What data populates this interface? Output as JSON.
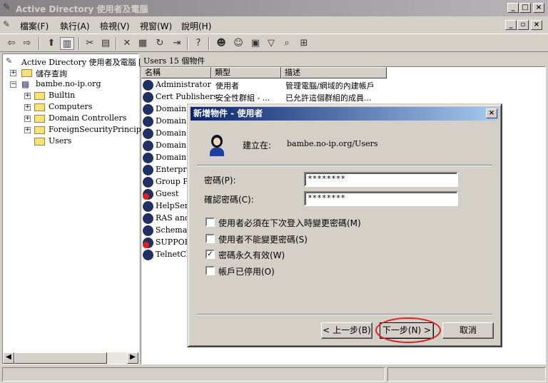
{
  "window": {
    "title": "Active Directory 使用者及電腦",
    "min": "_",
    "max": "□",
    "close": "×"
  },
  "menu": {
    "items": [
      "檔案(F)",
      "執行(A)",
      "檢視(V)",
      "視窗(W)",
      "說明(H)"
    ],
    "child_min": "_",
    "child_restore": "▫",
    "child_close": "×"
  },
  "tree": {
    "root": "Active Directory 使用者及電腦 [l",
    "saved_queries": "儲存查詢",
    "domain": "bambe.no-ip.org",
    "children": [
      "Builtin",
      "Computers",
      "Domain Controllers",
      "ForeignSecurityPrincipals",
      "Users"
    ]
  },
  "list": {
    "header": "Users   15 個物件",
    "columns": [
      "名稱",
      "類型",
      "描述"
    ],
    "rows": [
      {
        "name": "Administrator",
        "type": "使用者",
        "desc": "管理電腦/網域的內建帳戶",
        "error": false
      },
      {
        "name": "Cert Publishers",
        "type": "安全性群組 - ...",
        "desc": "已允許這個群組的成員...",
        "error": false
      },
      {
        "name": "Domain A",
        "type": "",
        "desc": "",
        "error": false
      },
      {
        "name": "Domain C",
        "type": "",
        "desc": "",
        "error": false
      },
      {
        "name": "Domain C",
        "type": "",
        "desc": "",
        "error": false
      },
      {
        "name": "Domain G",
        "type": "",
        "desc": "",
        "error": false
      },
      {
        "name": "Domain U",
        "type": "",
        "desc": "",
        "error": false
      },
      {
        "name": "Enterpris",
        "type": "",
        "desc": "",
        "error": false
      },
      {
        "name": "Group Po",
        "type": "",
        "desc": "",
        "error": false
      },
      {
        "name": "Guest",
        "type": "",
        "desc": "",
        "error": true
      },
      {
        "name": "HelpServ",
        "type": "",
        "desc": "",
        "error": false
      },
      {
        "name": "RAS and",
        "type": "",
        "desc": "",
        "error": false
      },
      {
        "name": "Schema A",
        "type": "",
        "desc": "",
        "error": false
      },
      {
        "name": "SUPPOR",
        "type": "",
        "desc": "",
        "error": true
      },
      {
        "name": "TelnetCli",
        "type": "",
        "desc": "",
        "error": false
      }
    ]
  },
  "dialog": {
    "title": "新增物件 - 使用者",
    "close": "×",
    "create_in_label": "建立在:",
    "create_in_value": "bambe.no-ip.org/Users",
    "password_label": "密碼(P):",
    "password_value": "********",
    "confirm_label": "確認密碼(C):",
    "confirm_value": "********",
    "options": [
      {
        "label": "使用者必須在下次登入時變更密碼(M)",
        "checked": false
      },
      {
        "label": "使用者不能變更密碼(S)",
        "checked": false
      },
      {
        "label": "密碼永久有效(W)",
        "checked": true
      },
      {
        "label": "帳戶已停用(O)",
        "checked": false
      }
    ],
    "back_button": "< 上一步(B)",
    "next_button": "下一步(N) >",
    "cancel_button": "取消",
    "highlight_color": "#e02020"
  },
  "scroll": {
    "left": "◀",
    "right": "▶"
  },
  "check_mark": "✓"
}
